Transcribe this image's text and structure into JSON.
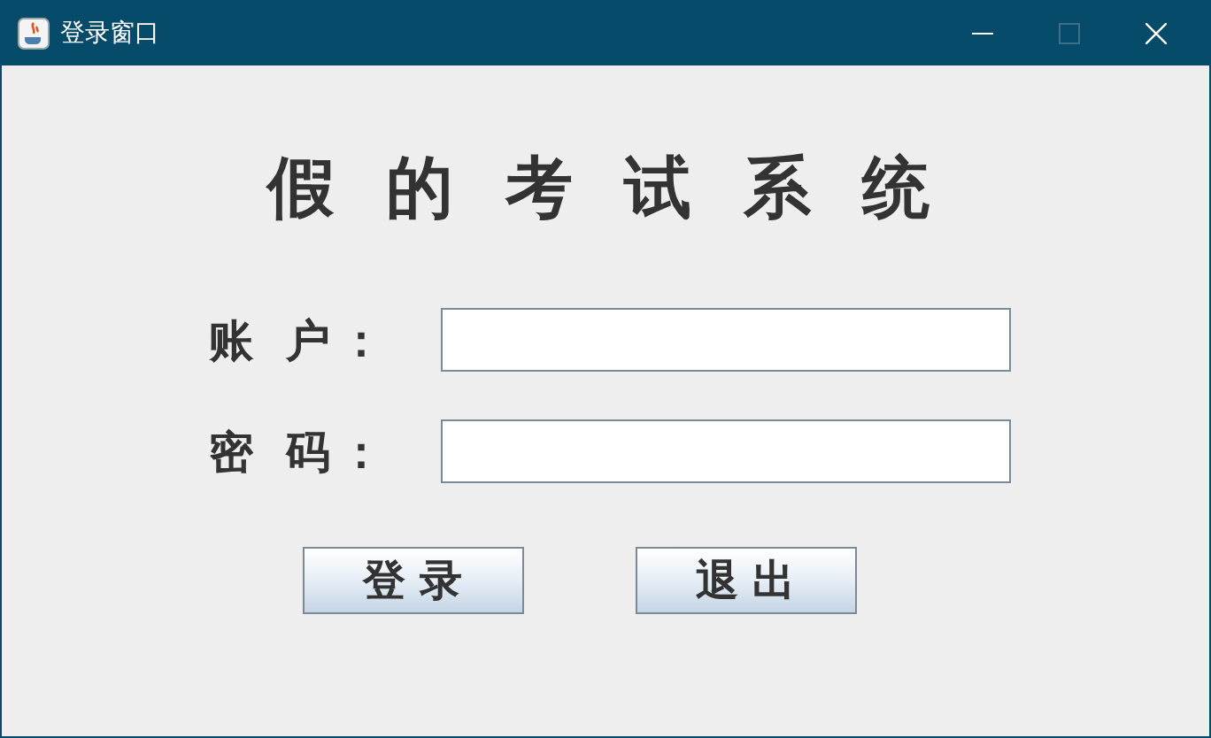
{
  "window": {
    "title": "登录窗口"
  },
  "heading": "假 的 考 试 系 统",
  "fields": [
    {
      "label": "账 户："
    },
    {
      "label": "密 码："
    }
  ],
  "buttons": [
    "登 录",
    "退 出"
  ]
}
